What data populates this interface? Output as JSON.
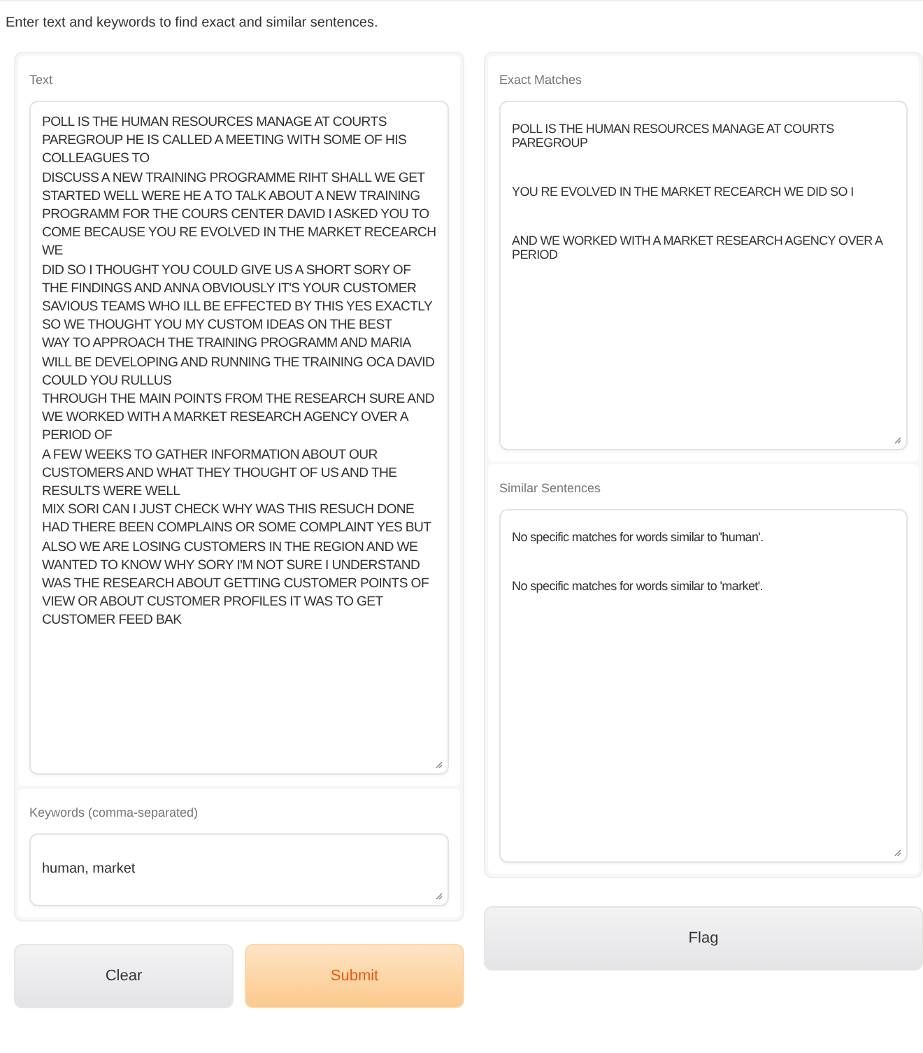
{
  "description": "Enter text and keywords to find exact and similar sentences.",
  "text_input": {
    "label": "Text",
    "lines": [
      "POLL IS THE HUMAN RESOURCES MANAGE AT COURTS PAREGROUP HE IS CALLED A MEETING WITH SOME OF HIS COLLEAGUES TO",
      "DISCUSS A NEW TRAINING PROGRAMME RIHT SHALL WE GET STARTED WELL WERE HE A TO TALK ABOUT A NEW TRAINING",
      "PROGRAMM FOR THE COURS CENTER DAVID I ASKED YOU TO COME BECAUSE YOU RE EVOLVED IN THE MARKET RECEARCH WE",
      "DID SO I THOUGHT YOU COULD GIVE US A SHORT SORY OF THE FINDINGS AND ANNA OBVIOUSLY IT'S YOUR CUSTOMER",
      "SAVIOUS TEAMS WHO ILL BE EFFECTED BY THIS YES EXACTLY SO WE THOUGHT YOU MY CUSTOM IDEAS ON THE BEST",
      "WAY TO APPROACH THE TRAINING PROGRAMM AND MARIA WILL BE DEVELOPING AND RUNNING THE TRAINING OCA DAVID COULD YOU RULLUS",
      "THROUGH THE MAIN POINTS FROM THE RESEARCH SURE AND WE WORKED WITH A MARKET RESEARCH AGENCY OVER A PERIOD OF",
      "A FEW WEEKS TO GATHER INFORMATION ABOUT OUR CUSTOMERS AND WHAT THEY THOUGHT OF US AND THE RESULTS WERE WELL",
      "MIX SORI CAN I JUST CHECK WHY WAS THIS RESUCH DONE HAD THERE BEEN COMPLAINS OR SOME COMPLAINT YES BUT",
      "ALSO WE ARE LOSING CUSTOMERS IN THE REGION AND WE WANTED TO KNOW WHY SORY I'M NOT SURE I UNDERSTAND",
      "WAS THE RESEARCH ABOUT GETTING CUSTOMER POINTS OF VIEW OR ABOUT CUSTOMER PROFILES IT WAS TO GET CUSTOMER FEED BAK"
    ]
  },
  "keywords": {
    "label": "Keywords (comma-separated)",
    "value": "human, market"
  },
  "buttons": [
    {
      "label": "Clear",
      "kind": "secondary"
    },
    {
      "label": "Submit",
      "kind": "primary"
    }
  ],
  "exact_matches": {
    "label": "Exact Matches",
    "lines": [
      "POLL IS THE HUMAN RESOURCES MANAGE AT COURTS PAREGROUP",
      "YOU RE EVOLVED IN THE MARKET RECEARCH WE DID SO I",
      "AND WE WORKED WITH A MARKET RESEARCH AGENCY OVER A PERIOD"
    ]
  },
  "similar_sentences": {
    "label": "Similar Sentences",
    "lines": [
      "No specific matches for words similar to 'human'.",
      "No specific matches for words similar to 'market'."
    ]
  },
  "flag_button": {
    "label": "Flag"
  }
}
